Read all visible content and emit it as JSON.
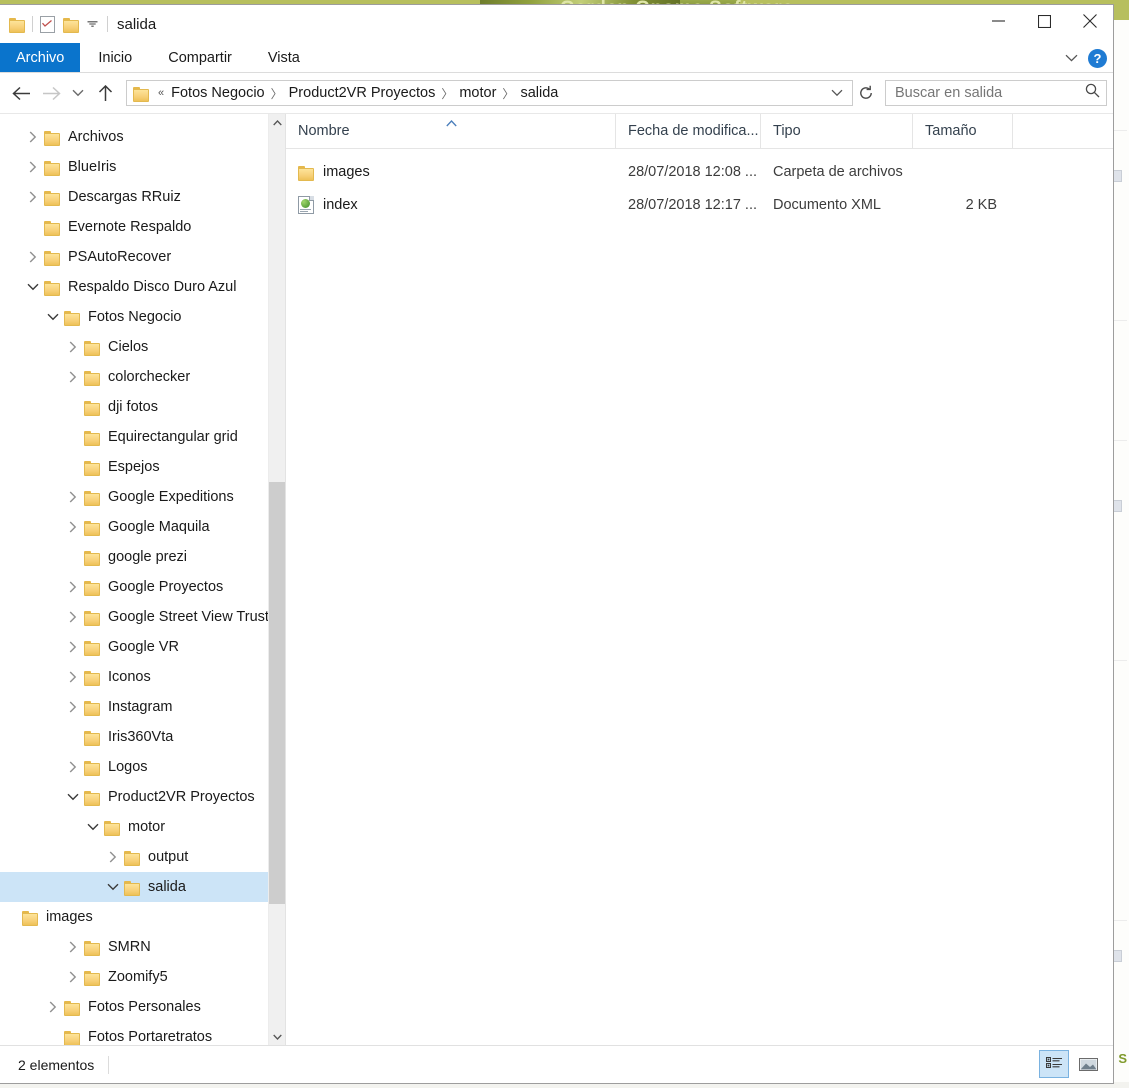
{
  "backdrop": {
    "site_title": "Garden Gnome Software"
  },
  "window": {
    "title": "salida",
    "quick_access": [
      {
        "name": "folder-icon",
        "label": "Propiedades"
      },
      {
        "name": "properties-icon",
        "label": "Propiedades"
      },
      {
        "name": "new-folder-icon",
        "label": "Nueva carpeta"
      }
    ],
    "controls": {
      "minimize": "Minimizar",
      "maximize": "Maximizar",
      "close": "Cerrar"
    }
  },
  "ribbon": {
    "tabs": [
      {
        "label": "Archivo",
        "active": true
      },
      {
        "label": "Inicio",
        "active": false
      },
      {
        "label": "Compartir",
        "active": false
      },
      {
        "label": "Vista",
        "active": false
      }
    ],
    "expand": "Expandir la cinta",
    "help": "?"
  },
  "navigation": {
    "back": "Atrás",
    "forward": "Adelante",
    "recent": "Ubicaciones recientes",
    "up": "Subir un nivel",
    "breadcrumb": {
      "overflow": "«",
      "items": [
        "Fotos Negocio",
        "Product2VR Proyectos",
        "motor",
        "salida"
      ]
    },
    "refresh": "Actualizar"
  },
  "search": {
    "placeholder": "Buscar en salida",
    "value": ""
  },
  "tree": {
    "items": [
      {
        "label": "Archivos",
        "depth": 0,
        "twisty": "collapsed",
        "selected": false
      },
      {
        "label": "BlueIris",
        "depth": 0,
        "twisty": "collapsed",
        "selected": false
      },
      {
        "label": "Descargas RRuiz",
        "depth": 0,
        "twisty": "collapsed",
        "selected": false
      },
      {
        "label": "Evernote Respaldo",
        "depth": 0,
        "twisty": "none",
        "selected": false
      },
      {
        "label": "PSAutoRecover",
        "depth": 0,
        "twisty": "collapsed",
        "selected": false
      },
      {
        "label": "Respaldo Disco Duro Azul",
        "depth": 0,
        "twisty": "expanded",
        "selected": false
      },
      {
        "label": "Fotos Negocio",
        "depth": 1,
        "twisty": "expanded",
        "selected": false
      },
      {
        "label": "Cielos",
        "depth": 2,
        "twisty": "collapsed",
        "selected": false
      },
      {
        "label": "colorchecker",
        "depth": 2,
        "twisty": "collapsed",
        "selected": false
      },
      {
        "label": "dji fotos",
        "depth": 2,
        "twisty": "none",
        "selected": false
      },
      {
        "label": "Equirectangular grid",
        "depth": 2,
        "twisty": "none",
        "selected": false
      },
      {
        "label": "Espejos",
        "depth": 2,
        "twisty": "none",
        "selected": false
      },
      {
        "label": "Google Expeditions",
        "depth": 2,
        "twisty": "collapsed",
        "selected": false
      },
      {
        "label": "Google Maquila",
        "depth": 2,
        "twisty": "collapsed",
        "selected": false
      },
      {
        "label": "google prezi",
        "depth": 2,
        "twisty": "none",
        "selected": false
      },
      {
        "label": "Google Proyectos",
        "depth": 2,
        "twisty": "collapsed",
        "selected": false
      },
      {
        "label": "Google Street View Trusted",
        "depth": 2,
        "twisty": "collapsed",
        "selected": false
      },
      {
        "label": "Google VR",
        "depth": 2,
        "twisty": "collapsed",
        "selected": false
      },
      {
        "label": "Iconos",
        "depth": 2,
        "twisty": "collapsed",
        "selected": false
      },
      {
        "label": "Instagram",
        "depth": 2,
        "twisty": "collapsed",
        "selected": false
      },
      {
        "label": "Iris360Vta",
        "depth": 2,
        "twisty": "none",
        "selected": false
      },
      {
        "label": "Logos",
        "depth": 2,
        "twisty": "collapsed",
        "selected": false
      },
      {
        "label": "Product2VR Proyectos",
        "depth": 2,
        "twisty": "expanded",
        "selected": false
      },
      {
        "label": "motor",
        "depth": 3,
        "twisty": "expanded",
        "selected": false
      },
      {
        "label": "output",
        "depth": 4,
        "twisty": "collapsed",
        "selected": false
      },
      {
        "label": "salida",
        "depth": 4,
        "twisty": "expanded",
        "selected": true
      },
      {
        "label": "images",
        "depth": 5,
        "twisty": "none",
        "selected": false
      },
      {
        "label": "SMRN",
        "depth": 2,
        "twisty": "collapsed",
        "selected": false
      },
      {
        "label": "Zoomify5",
        "depth": 2,
        "twisty": "collapsed",
        "selected": false
      },
      {
        "label": "Fotos Personales",
        "depth": 1,
        "twisty": "collapsed",
        "selected": false
      },
      {
        "label": "Fotos Portaretratos",
        "depth": 1,
        "twisty": "none",
        "selected": false
      }
    ]
  },
  "filelist": {
    "columns": [
      {
        "label": "Nombre",
        "sorted": "asc"
      },
      {
        "label": "Fecha de modifica...",
        "sorted": "none"
      },
      {
        "label": "Tipo",
        "sorted": "none"
      },
      {
        "label": "Tamaño",
        "sorted": "none"
      }
    ],
    "rows": [
      {
        "icon": "folder-icon",
        "name": "images",
        "date": "28/07/2018 12:08 ...",
        "type": "Carpeta de archivos",
        "size": ""
      },
      {
        "icon": "xml-document-icon",
        "name": "index",
        "date": "28/07/2018 12:17 ...",
        "type": "Documento XML",
        "size": "2 KB"
      }
    ]
  },
  "statusbar": {
    "count_text": "2 elementos",
    "views": [
      {
        "name": "details-view-button",
        "label": "Detalles",
        "active": true
      },
      {
        "name": "large-icons-view-button",
        "label": "Iconos grandes",
        "active": false
      }
    ]
  },
  "colors": {
    "accent": "#0a74cc",
    "selection": "#cce4f7",
    "folder": "#f7d078",
    "backdrop_green": "#b7bf5e"
  }
}
